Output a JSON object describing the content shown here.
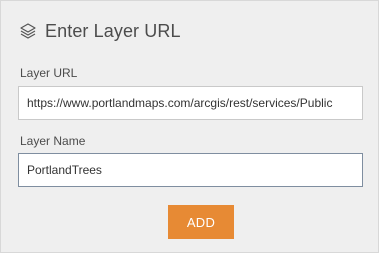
{
  "header": {
    "title": "Enter Layer URL",
    "icon": "layers-icon"
  },
  "form": {
    "layer_url": {
      "label": "Layer URL",
      "value": "https://www.portlandmaps.com/arcgis/rest/services/Public"
    },
    "layer_name": {
      "label": "Layer Name",
      "value": "PortlandTrees"
    },
    "add_label": "ADD"
  },
  "colors": {
    "panel_bg": "#efefef",
    "accent": "#e78a34",
    "text": "#4c4c4c"
  }
}
